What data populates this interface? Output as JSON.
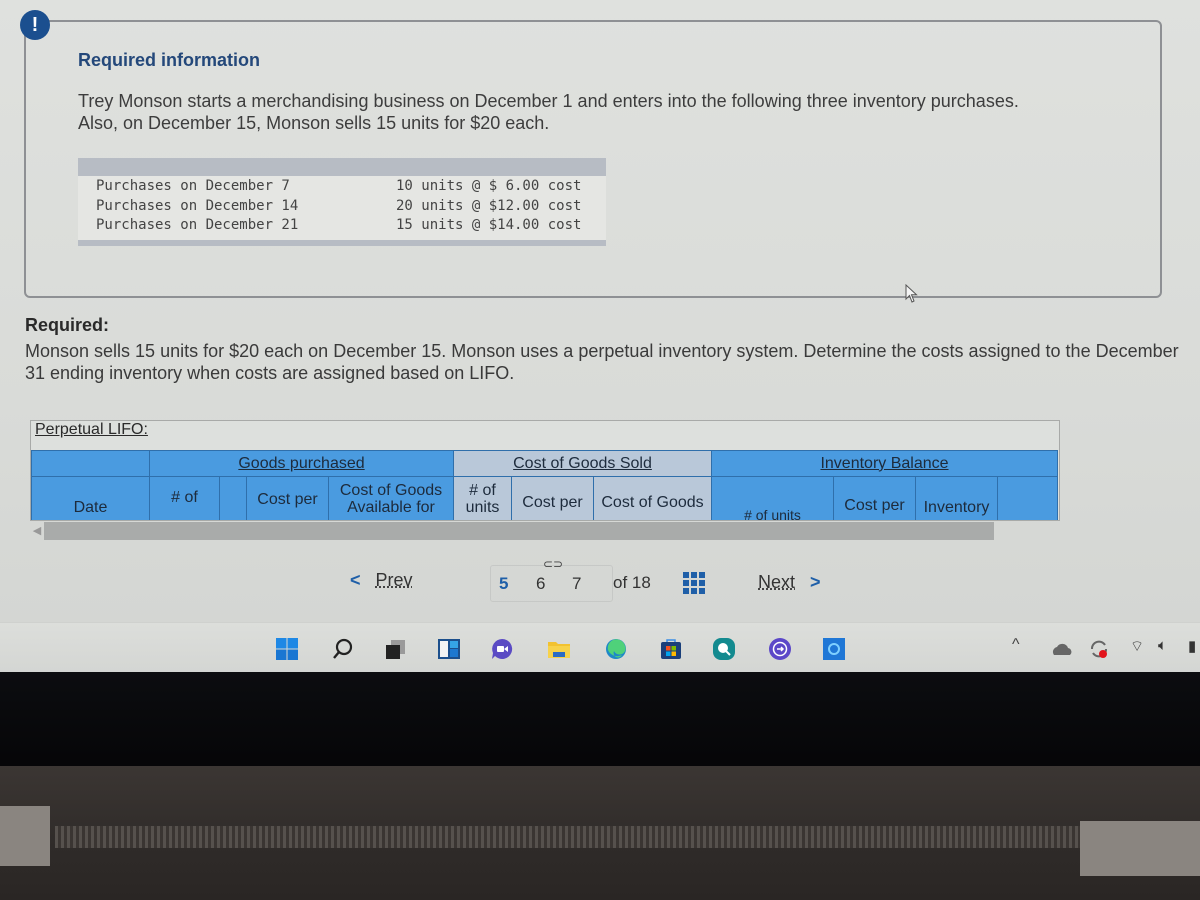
{
  "alert": {
    "icon": "!"
  },
  "info": {
    "title": "Required information",
    "text": "Trey Monson starts a merchandising business on December 1 and enters into the following three inventory purchases. Also, on December 15, Monson sells 15 units for $20 each.",
    "purchases": [
      {
        "label": "Purchases on December 7",
        "detail": "10 units @ $ 6.00 cost"
      },
      {
        "label": "Purchases on December 14",
        "detail": "20 units @ $12.00 cost"
      },
      {
        "label": "Purchases on December 21",
        "detail": "15 units @ $14.00 cost"
      }
    ]
  },
  "required": {
    "title": "Required:",
    "text": "Monson sells 15 units for $20 each on December 15. Monson uses a perpetual inventory system. Determine the costs assigned to the December 31 ending inventory when costs are assigned based on LIFO."
  },
  "lifo": {
    "label": "Perpetual LIFO:",
    "groups": {
      "purchased": "Goods purchased",
      "cogs": "Cost of Goods Sold",
      "balance": "Inventory Balance"
    },
    "headers": {
      "date": "Date",
      "purchased_units": "# of",
      "purchased_cost_per": "Cost per",
      "purchased_available": "Cost of Goods Available for",
      "cogs_units": "# of units",
      "cogs_cost_per": "Cost per",
      "cogs_cost": "Cost of Goods",
      "bal_units": "# of units",
      "bal_cost_per": "Cost per",
      "bal_inventory": "Inventory"
    }
  },
  "pager": {
    "prev": "Prev",
    "next": "Next",
    "pages": [
      "5",
      "6",
      "7"
    ],
    "current": "5",
    "of_label": "of 18"
  },
  "colors": {
    "header_blue": "#4a9be0",
    "header_grey": "#b9c8d9",
    "accent": "#1f5fa8",
    "title_blue": "#24487a"
  }
}
